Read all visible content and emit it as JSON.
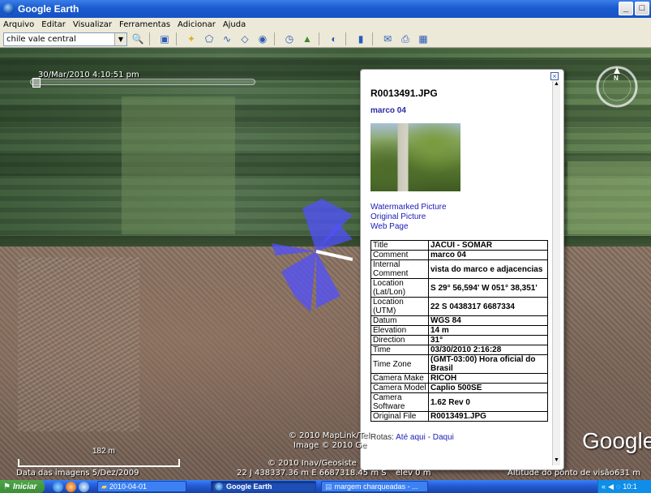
{
  "window": {
    "title": "Google Earth",
    "controls": [
      "_",
      "□"
    ]
  },
  "menu": [
    "Arquivo",
    "Editar",
    "Visualizar",
    "Ferramentas",
    "Adicionar",
    "Ajuda"
  ],
  "toolbar": {
    "search_value": "chile vale central",
    "search_icon": "magnifier-icon",
    "buttons": [
      "sidebar-toggle-icon",
      "placemark-icon",
      "polygon-icon",
      "path-icon",
      "overlay-icon",
      "record-tour-icon",
      "historical-imagery-icon",
      "sun-icon",
      "planets-icon",
      "ruler-icon",
      "email-icon",
      "print-icon",
      "maps-icon"
    ]
  },
  "timeslider": {
    "date_label": "30/Mar/2010  4:10:51 pm",
    "position": 0.01
  },
  "balloon": {
    "title": "R0013491.JPG",
    "subtitle": "marco 04",
    "links": [
      "Watermarked Picture",
      "Original Picture",
      "Web Page"
    ],
    "properties": [
      {
        "k": "Title",
        "v": "JACUI - SOMAR"
      },
      {
        "k": "Comment",
        "v": "marco 04"
      },
      {
        "k": "Internal Comment",
        "v": "vista do marco e adjacencias"
      },
      {
        "k": "Location (Lat/Lon)",
        "v": "S 29° 56,594' W 051° 38,351'"
      },
      {
        "k": "Location (UTM)",
        "v": "22 S 0438317 6687334"
      },
      {
        "k": "Datum",
        "v": "WGS 84"
      },
      {
        "k": "Elevation",
        "v": "14 m"
      },
      {
        "k": "Direction",
        "v": "31°"
      },
      {
        "k": "Time",
        "v": "03/30/2010 2:16:28"
      },
      {
        "k": "Time Zone",
        "v": "(GMT-03:00) Hora oficial do Brasil"
      },
      {
        "k": "Camera Make",
        "v": "RICOH"
      },
      {
        "k": "Camera Model",
        "v": "Caplio 500SE"
      },
      {
        "k": "Camera Software",
        "v": "1.62 Rev 0"
      },
      {
        "k": "Original File",
        "v": "R0013491.JPG"
      }
    ],
    "rotas_label": "Rotas:",
    "rotas_to": "Até aqui",
    "rotas_from": "Daqui"
  },
  "map": {
    "copyright_1": "© 2010 MapLink/Tel",
    "copyright_2": "Image © 2010 Ge",
    "copyright_3": "© 2010 Inav/Geosiste",
    "google_logo": "Google",
    "scale_label": "182 m",
    "status_date": "Data das imagens  5/Dez/2009",
    "status_coords": "22 J 438337.36 m E 6687318.45 m S",
    "status_elev": "elev   0 m",
    "status_eye_label": "Altitude do ponto de visão",
    "status_eye_value": "631 m"
  },
  "taskbar": {
    "start_label": "Iniciar",
    "tasks": [
      "2010-04-01",
      "Google Earth",
      "margem charqueadas - ..."
    ],
    "clock": "10:1"
  }
}
